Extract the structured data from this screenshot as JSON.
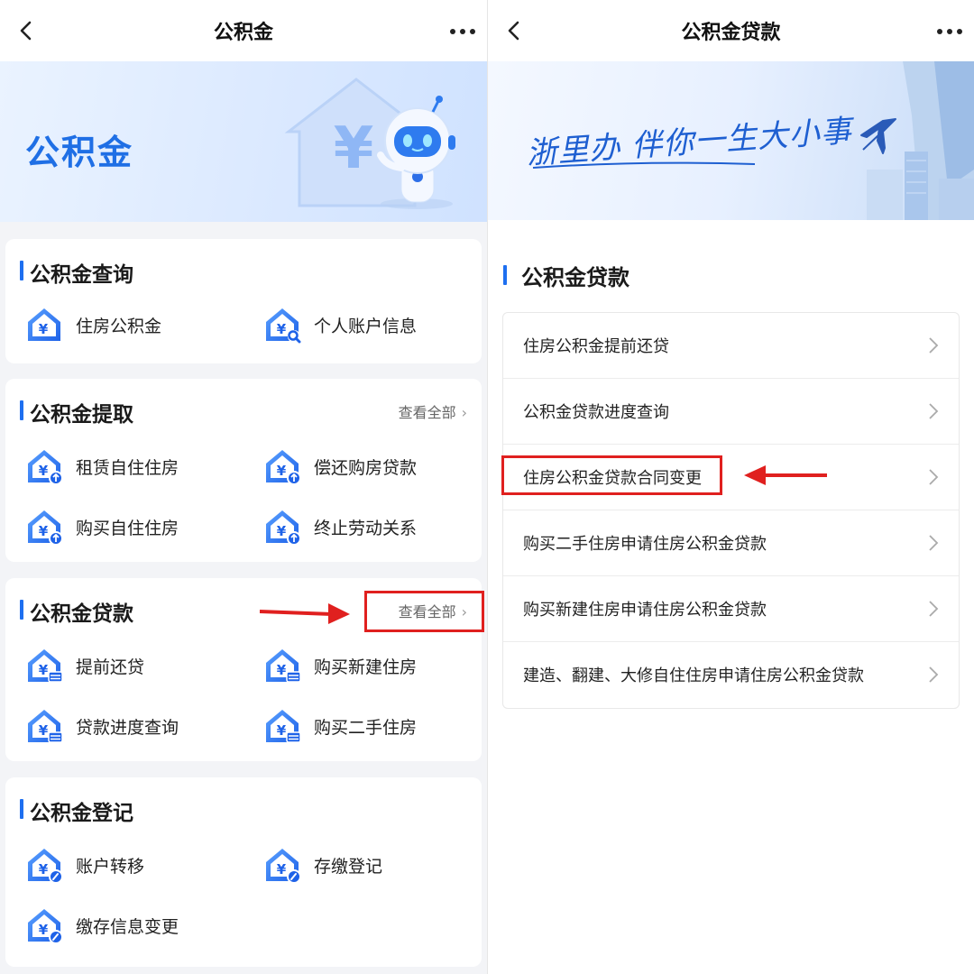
{
  "left": {
    "nav": {
      "title": "公积金"
    },
    "banner": {
      "title": "公积金"
    },
    "sections": [
      {
        "title": "公积金查询",
        "view_all": "",
        "items": [
          {
            "label": "住房公积金",
            "icon": "house-yen-icon"
          },
          {
            "label": "个人账户信息",
            "icon": "house-yen-search-icon"
          }
        ]
      },
      {
        "title": "公积金提取",
        "view_all": "查看全部",
        "items": [
          {
            "label": "租赁自住住房",
            "icon": "house-yen-upload-icon"
          },
          {
            "label": "偿还购房贷款",
            "icon": "house-yen-upload-icon"
          },
          {
            "label": "购买自住住房",
            "icon": "house-yen-upload-icon"
          },
          {
            "label": "终止劳动关系",
            "icon": "house-yen-upload-icon"
          }
        ]
      },
      {
        "title": "公积金贷款",
        "view_all": "查看全部",
        "items": [
          {
            "label": "提前还贷",
            "icon": "house-yen-card-icon"
          },
          {
            "label": "购买新建住房",
            "icon": "house-yen-card-icon"
          },
          {
            "label": "贷款进度查询",
            "icon": "house-yen-card-icon"
          },
          {
            "label": "购买二手住房",
            "icon": "house-yen-card-icon"
          }
        ]
      },
      {
        "title": "公积金登记",
        "view_all": "",
        "items": [
          {
            "label": "账户转移",
            "icon": "house-yen-edit-icon"
          },
          {
            "label": "存缴登记",
            "icon": "house-yen-edit-icon"
          },
          {
            "label": "缴存信息变更",
            "icon": "house-yen-edit-icon"
          }
        ]
      }
    ]
  },
  "right": {
    "nav": {
      "title": "公积金贷款"
    },
    "banner": {
      "slogan": "浙里办 伴你一生大小事"
    },
    "section_title": "公积金贷款",
    "rows": [
      "住房公积金提前还贷",
      "公积金贷款进度查询",
      "住房公积金贷款合同变更",
      "购买二手住房申请住房公积金贷款",
      "购买新建住房申请住房公积金贷款",
      "建造、翻建、大修自住住房申请住房公积金贷款"
    ]
  },
  "colors": {
    "accent": "#1e6ff0",
    "annotation": "#e0201f"
  }
}
